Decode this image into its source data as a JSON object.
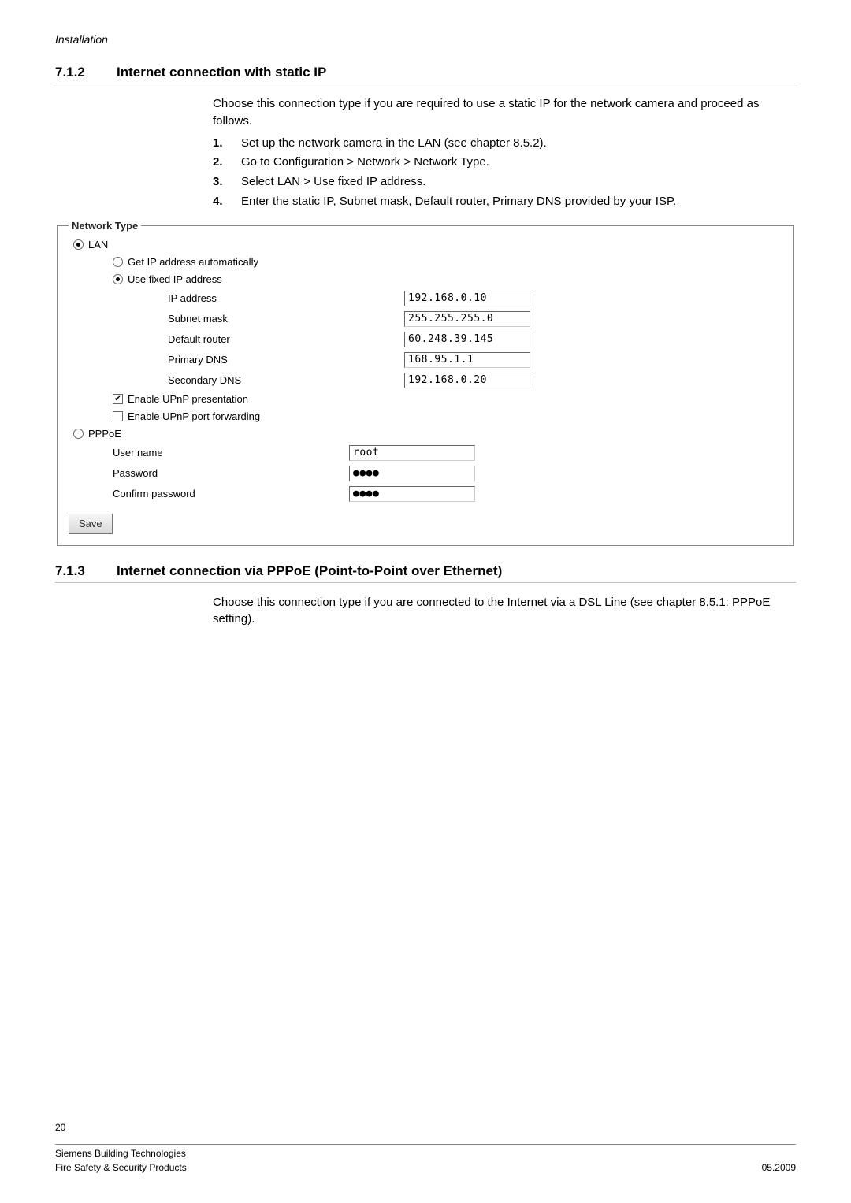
{
  "header": {
    "title": "Installation"
  },
  "section1": {
    "number": "7.1.2",
    "title": "Internet connection with static IP",
    "intro": "Choose this connection type if you are required to use a static IP for the network camera and proceed as follows.",
    "steps": [
      {
        "n": "1.",
        "t": "Set up the network camera in the LAN (see chapter 8.5.2)."
      },
      {
        "n": "2.",
        "t": "Go to Configuration > Network > Network Type."
      },
      {
        "n": "3.",
        "t": "Select LAN > Use fixed IP address."
      },
      {
        "n": "4.",
        "t": "Enter the static IP, Subnet mask, Default router, Primary DNS provided by your ISP."
      }
    ]
  },
  "form": {
    "legend": "Network Type",
    "lan_label": "LAN",
    "get_ip_label": "Get IP address automatically",
    "use_fixed_label": "Use fixed IP address",
    "ip_address_label": "IP address",
    "ip_address_value": "192.168.0.10",
    "subnet_label": "Subnet mask",
    "subnet_value": "255.255.255.0",
    "router_label": "Default router",
    "router_value": "60.248.39.145",
    "pdns_label": "Primary DNS",
    "pdns_value": "168.95.1.1",
    "sdns_label": "Secondary DNS",
    "sdns_value": "192.168.0.20",
    "upnp_pres_label": "Enable UPnP presentation",
    "upnp_port_label": "Enable UPnP port forwarding",
    "pppoe_label": "PPPoE",
    "user_label": "User name",
    "user_value": "root",
    "pass_label": "Password",
    "pass_value": "●●●●",
    "cpass_label": "Confirm password",
    "cpass_value": "●●●●",
    "save_label": "Save"
  },
  "section2": {
    "number": "7.1.3",
    "title": "Internet connection via PPPoE (Point-to-Point over Ethernet)",
    "text": "Choose this connection type if you are connected to the Internet via a DSL Line (see chapter 8.5.1: PPPoE setting)."
  },
  "footer": {
    "page": "20",
    "l1": "Siemens Building Technologies",
    "l2": "Fire Safety & Security Products",
    "date": "05.2009"
  }
}
